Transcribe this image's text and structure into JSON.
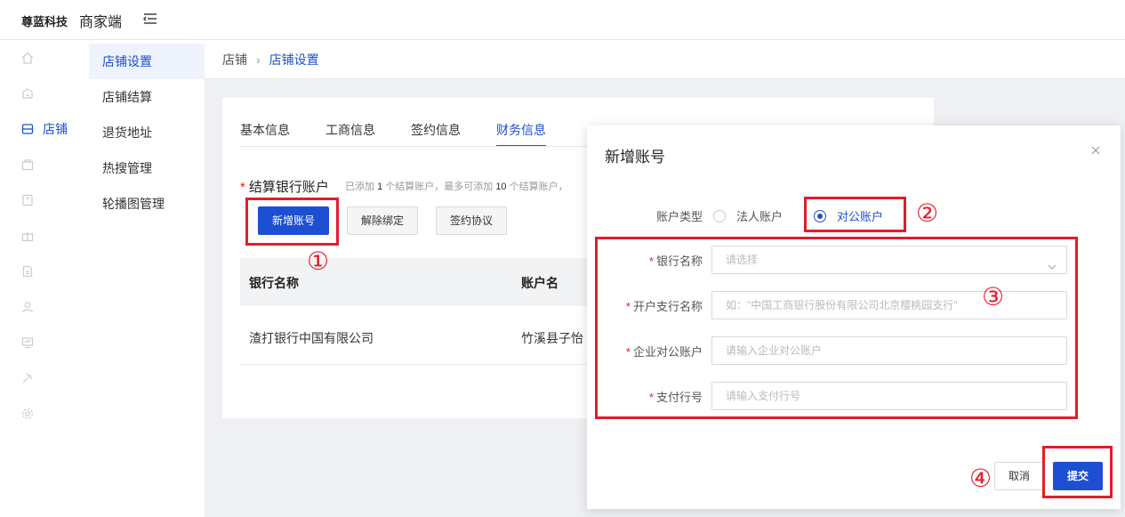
{
  "header": {
    "logo": "尊蓝科技",
    "app_name": "商家端"
  },
  "sidebar": {
    "items": [
      {
        "label": "首页",
        "icon": "home-icon"
      },
      {
        "label": "公告",
        "icon": "notice-icon"
      },
      {
        "label": "店铺",
        "icon": "shop-icon"
      },
      {
        "label": "库存",
        "icon": "inventory-icon"
      },
      {
        "label": "商品",
        "icon": "goods-icon"
      },
      {
        "label": "营销",
        "icon": "gift-icon"
      },
      {
        "label": "订单",
        "icon": "order-icon"
      },
      {
        "label": "客户",
        "icon": "user-icon"
      },
      {
        "label": "数据",
        "icon": "data-icon"
      },
      {
        "label": "装修",
        "icon": "decorate-icon"
      },
      {
        "label": "系统",
        "icon": "gear-icon"
      }
    ],
    "active_index": 2
  },
  "submenu": {
    "items": [
      "店铺设置",
      "店铺结算",
      "退货地址",
      "热搜管理",
      "轮播图管理"
    ],
    "active_index": 0
  },
  "breadcrumb": {
    "root": "店铺",
    "current": "店铺设置"
  },
  "tabs": [
    "基本信息",
    "工商信息",
    "签约信息",
    "财务信息"
  ],
  "active_tab": 3,
  "section": {
    "title": "结算银行账户",
    "hint_1": "已添加",
    "hint_count": "1",
    "hint_2": "个结算账户，最多可添加",
    "hint_max": "10",
    "hint_3": "个结算账户，"
  },
  "buttons": {
    "add_account": "新增账号",
    "unbind": "解除绑定",
    "sign_agreement": "签约协议"
  },
  "table": {
    "columns": [
      "银行名称",
      "账户名"
    ],
    "rows": [
      [
        "渣打银行中国有限公司",
        "竹溪县子怡"
      ]
    ]
  },
  "modal": {
    "title": "新增账号",
    "account_type_label": "账户类型",
    "account_type_options": [
      "法人账户",
      "对公账户"
    ],
    "account_type_selected": "对公账户",
    "fields": [
      {
        "label": "银行名称",
        "placeholder": "请选择",
        "required": true
      },
      {
        "label": "开户支行名称",
        "placeholder": "如：\"中国工商银行股份有限公司北京樱桃园支行\"",
        "required": true
      },
      {
        "label": "企业对公账户",
        "placeholder": "请输入企业对公账户",
        "required": true
      },
      {
        "label": "支付行号",
        "placeholder": "请输入支付行号",
        "required": true
      }
    ],
    "cancel_label": "取消",
    "submit_label": "提交"
  },
  "annotations": [
    "①",
    "②",
    "③",
    "④"
  ],
  "colors": {
    "primary": "#1d4fd3",
    "sidebar_bg": "#ffffff",
    "annotation_red": "#e01e2a",
    "required_red": "#e02020"
  }
}
